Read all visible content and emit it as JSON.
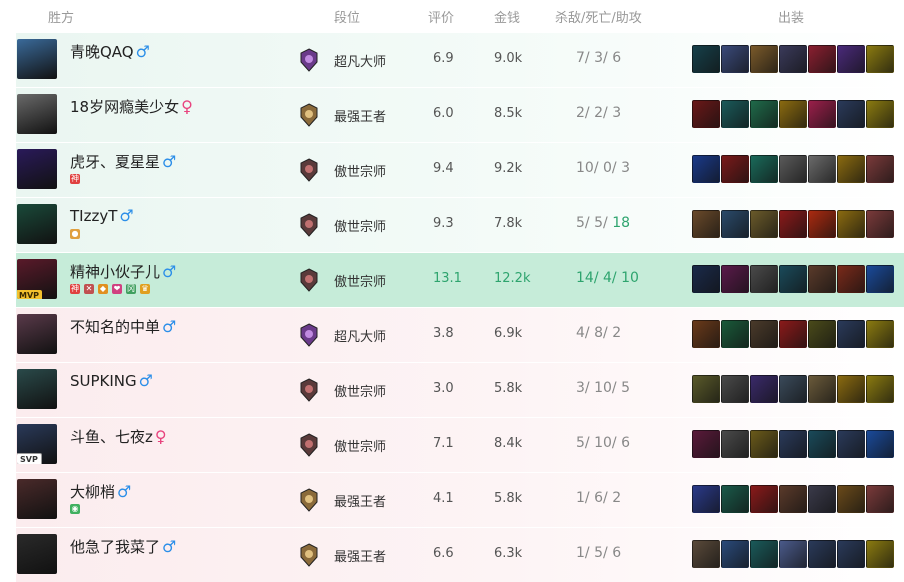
{
  "headers": {
    "team": "胜方",
    "rank": "段位",
    "score": "评价",
    "gold": "金钱",
    "kda": "杀敌/死亡/助攻",
    "items": "出装"
  },
  "players": [
    {
      "name": "青晚QAQ",
      "gender": "♂",
      "rank": "超凡大师",
      "score": "6.9",
      "gold": "9.0k",
      "k": "7",
      "d": "3",
      "a": "6",
      "result": "win"
    },
    {
      "name": "18岁网瘾美少女",
      "gender": "♀",
      "rank": "最强王者",
      "score": "6.0",
      "gold": "8.5k",
      "k": "2",
      "d": "2",
      "a": "3",
      "result": "win"
    },
    {
      "name": "虎牙、夏星星",
      "gender": "♂",
      "rank": "傲世宗师",
      "score": "9.4",
      "gold": "9.2k",
      "k": "10",
      "d": "0",
      "a": "3",
      "result": "win",
      "badges": [
        "shen"
      ]
    },
    {
      "name": "TIzzyT",
      "gender": "♂",
      "rank": "傲世宗师",
      "score": "9.3",
      "gold": "7.8k",
      "k": "5",
      "d": "5",
      "a": "18",
      "result": "win",
      "badges": [
        "orange"
      ]
    },
    {
      "name": "精神小伙子儿",
      "gender": "♂",
      "rank": "傲世宗师",
      "score": "13.1",
      "gold": "12.2k",
      "k": "14",
      "d": "4",
      "a": "10",
      "result": "mvp",
      "tag": "MVP",
      "badges": [
        "shen",
        "sword",
        "gold",
        "pink",
        "green",
        "crown"
      ]
    },
    {
      "name": "不知名的中单",
      "gender": "♂",
      "rank": "超凡大师",
      "score": "3.8",
      "gold": "6.9k",
      "k": "4",
      "d": "8",
      "a": "2",
      "result": "lose"
    },
    {
      "name": "SUPKING",
      "gender": "♂",
      "rank": "傲世宗师",
      "score": "3.0",
      "gold": "5.8k",
      "k": "3",
      "d": "10",
      "a": "5",
      "result": "lose"
    },
    {
      "name": "斗鱼、七夜z",
      "gender": "♀",
      "rank": "傲世宗师",
      "score": "7.1",
      "gold": "8.4k",
      "k": "5",
      "d": "10",
      "a": "6",
      "result": "lose",
      "tag": "SVP"
    },
    {
      "name": "大柳梢",
      "gender": "♂",
      "rank": "最强王者",
      "score": "4.1",
      "gold": "5.8k",
      "k": "1",
      "d": "6",
      "a": "2",
      "result": "lose",
      "badges": [
        "greenshield"
      ]
    },
    {
      "name": "他急了我菜了",
      "gender": "♂",
      "rank": "最强王者",
      "score": "6.6",
      "gold": "6.3k",
      "k": "1",
      "d": "5",
      "a": "6",
      "result": "lose"
    }
  ],
  "colors": {
    "win_bg": "#eaf6f1",
    "lose_bg": "#fbecee",
    "mvp_bg": "#c6ecd9",
    "highlight": "#2ea46e",
    "male": "#2b8ee8",
    "female": "#e8437e"
  }
}
